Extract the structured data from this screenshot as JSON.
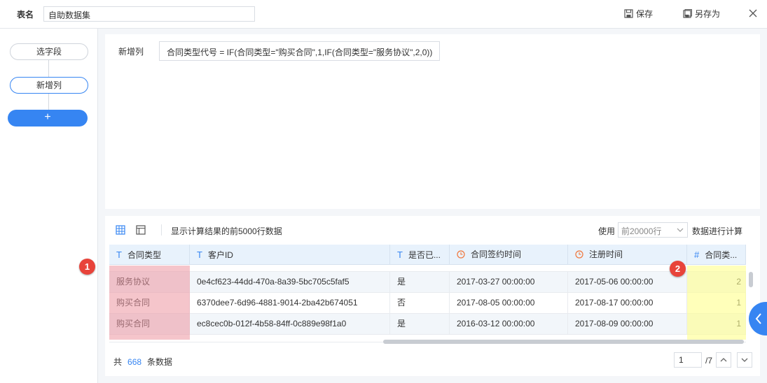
{
  "topbar": {
    "table_name_label": "表名",
    "table_name_value": "自助数据集",
    "save_label": "保存",
    "save_as_label": "另存为"
  },
  "steps": {
    "items": [
      {
        "label": "选字段"
      },
      {
        "label": "新增列"
      }
    ],
    "add_label": "+"
  },
  "formula": {
    "label": "新增列",
    "expression": "合同类型代号 = IF(合同类型=\"购买合同\",1,IF(合同类型=\"服务协议\",2,0))"
  },
  "preview": {
    "hint": "显示计算结果的前5000行数据",
    "use_label": "使用",
    "row_limit": "前20000行",
    "calc_label": "数据进行计算",
    "columns": [
      {
        "type_icon": "T",
        "name": "合同类型"
      },
      {
        "type_icon": "T",
        "name": "客户ID"
      },
      {
        "type_icon": "T",
        "name": "是否已..."
      },
      {
        "type_icon": "clock",
        "name": "合同签约时间"
      },
      {
        "type_icon": "clock",
        "name": "注册时间"
      },
      {
        "type_icon": "#",
        "name": "合同类..."
      }
    ],
    "rows": [
      [
        "服务协议",
        "0e4cf623-44dd-470a-8a39-5bc705c5faf5",
        "是",
        "2017-03-27 00:00:00",
        "2017-05-06 00:00:00",
        "2"
      ],
      [
        "购买合同",
        "6370dee7-6d96-4881-9014-2ba42b674051",
        "否",
        "2017-08-05 00:00:00",
        "2017-08-17 00:00:00",
        "1"
      ],
      [
        "购买合同",
        "ec8cec0b-012f-4b58-84ff-0c889e98f1a0",
        "是",
        "2016-03-12 00:00:00",
        "2017-08-09 00:00:00",
        "1"
      ]
    ],
    "total_prefix": "共",
    "total_count": "668",
    "total_suffix": "条数据",
    "page_current": "1",
    "page_total": "/7"
  },
  "annotations": [
    "1",
    "2"
  ],
  "colors": {
    "accent": "#3685f2",
    "highlight_red": "#ec96a0",
    "highlight_yellow": "#ffff8c",
    "badge": "#e8433a"
  }
}
